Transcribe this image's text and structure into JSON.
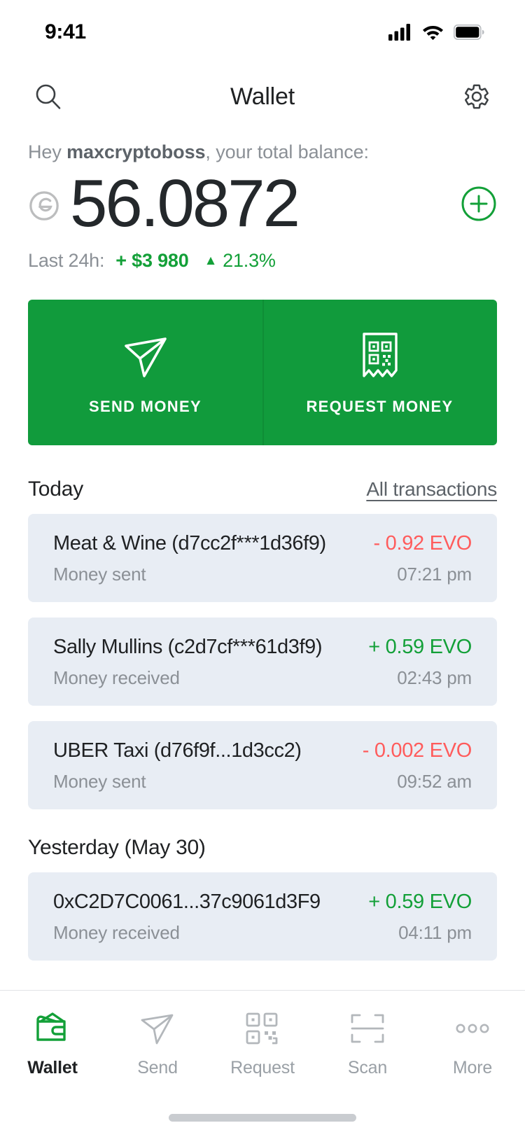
{
  "status_bar": {
    "time": "9:41",
    "cellular_icon": "cellular-signal-icon",
    "wifi_icon": "wifi-icon",
    "battery_icon": "battery-full-icon"
  },
  "header": {
    "title": "Wallet",
    "search_icon": "search-icon",
    "settings_icon": "gear-icon"
  },
  "balance": {
    "greeting_prefix": "Hey ",
    "username": "maxcryptoboss",
    "greeting_suffix": ", your total balance:",
    "amount": "56.0872",
    "coin_icon": "evo-coin-icon",
    "add_icon": "plus-circle-icon",
    "last24_label": "Last 24h:",
    "last24_amount": "+ $3 980",
    "last24_caret": "▲",
    "last24_percent": "21.3%",
    "positive_color": "#13a038"
  },
  "actions": {
    "accent_color": "#119b3c",
    "items": [
      {
        "label": "SEND MONEY",
        "icon": "send-plane-icon"
      },
      {
        "label": "REQUEST MONEY",
        "icon": "qr-receipt-icon"
      }
    ]
  },
  "transactions": {
    "today_title": "Today",
    "all_link": "All transactions",
    "yesterday_title": "Yesterday (May 30)",
    "card_bg": "#e8edf4",
    "negative_color": "#ff5c5c",
    "positive_color": "#13a038",
    "today": [
      {
        "title": "Meat & Wine (d7cc2f***1d36f9)",
        "amount": "- 0.92 EVO",
        "direction": "neg",
        "subtitle": "Money sent",
        "time": "07:21 pm"
      },
      {
        "title": "Sally Mullins (c2d7cf***61d3f9)",
        "amount": "+ 0.59 EVO",
        "direction": "pos",
        "subtitle": "Money received",
        "time": "02:43 pm"
      },
      {
        "title": "UBER Taxi (d76f9f...1d3cc2)",
        "amount": "- 0.002 EVO",
        "direction": "neg",
        "subtitle": "Money sent",
        "time": "09:52 am"
      }
    ],
    "yesterday": [
      {
        "title": "0xC2D7C0061...37c9061d3F9",
        "amount": "+ 0.59 EVO",
        "direction": "pos",
        "subtitle": "Money received",
        "time": "04:11 pm"
      }
    ]
  },
  "bottom_nav": {
    "active_color": "#13a038",
    "items": [
      {
        "label": "Wallet",
        "icon": "wallet-icon",
        "active": true
      },
      {
        "label": "Send",
        "icon": "send-plane-icon",
        "active": false
      },
      {
        "label": "Request",
        "icon": "qr-code-icon",
        "active": false
      },
      {
        "label": "Scan",
        "icon": "scan-frame-icon",
        "active": false
      },
      {
        "label": "More",
        "icon": "more-dots-icon",
        "active": false
      }
    ]
  }
}
